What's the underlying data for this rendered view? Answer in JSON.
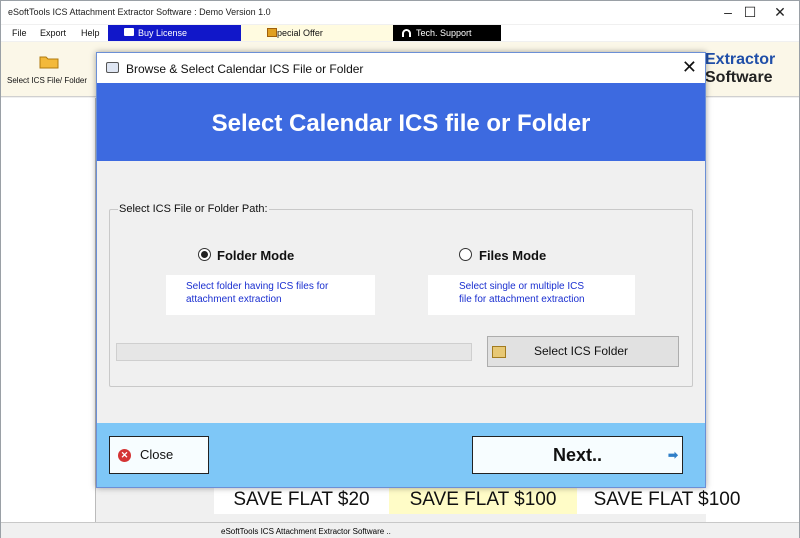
{
  "app": {
    "title": "eSoftTools ICS Attachment Extractor Software : Demo Version 1.0"
  },
  "window_controls": {
    "minimize": "–",
    "maximize": "☐",
    "close": "✕"
  },
  "menu": {
    "file": "File",
    "export": "Export",
    "help": "Help",
    "buy": "Buy License",
    "offer": "Special Offer",
    "support": "Tech. Support"
  },
  "toolbar": {
    "select_label": "Select ICS File/ Folder"
  },
  "brand": {
    "line1": "Extractor",
    "line2": "Software"
  },
  "status": {
    "text": "eSoftTools ICS Attachment Extractor Software  .."
  },
  "ads": [
    "SAVE FLAT $20",
    "SAVE FLAT $100",
    "SAVE FLAT $100"
  ],
  "dialog": {
    "title": "Browse & Select Calendar ICS File or Folder",
    "close": "✕",
    "banner": "Select Calendar ICS file or Folder",
    "group_label": "Select ICS File or Folder Path:",
    "folder_mode": "Folder Mode",
    "files_mode": "Files Mode",
    "folder_desc_1": "Select folder having ICS files for",
    "folder_desc_2": "attachment extraction",
    "files_desc_1": "Select single or multiple ICS",
    "files_desc_2": "file for attachment extraction",
    "path_value": "",
    "select_button": "Select ICS Folder",
    "close_button": "Close",
    "next_button": "Next..",
    "selected_mode": "folder"
  }
}
